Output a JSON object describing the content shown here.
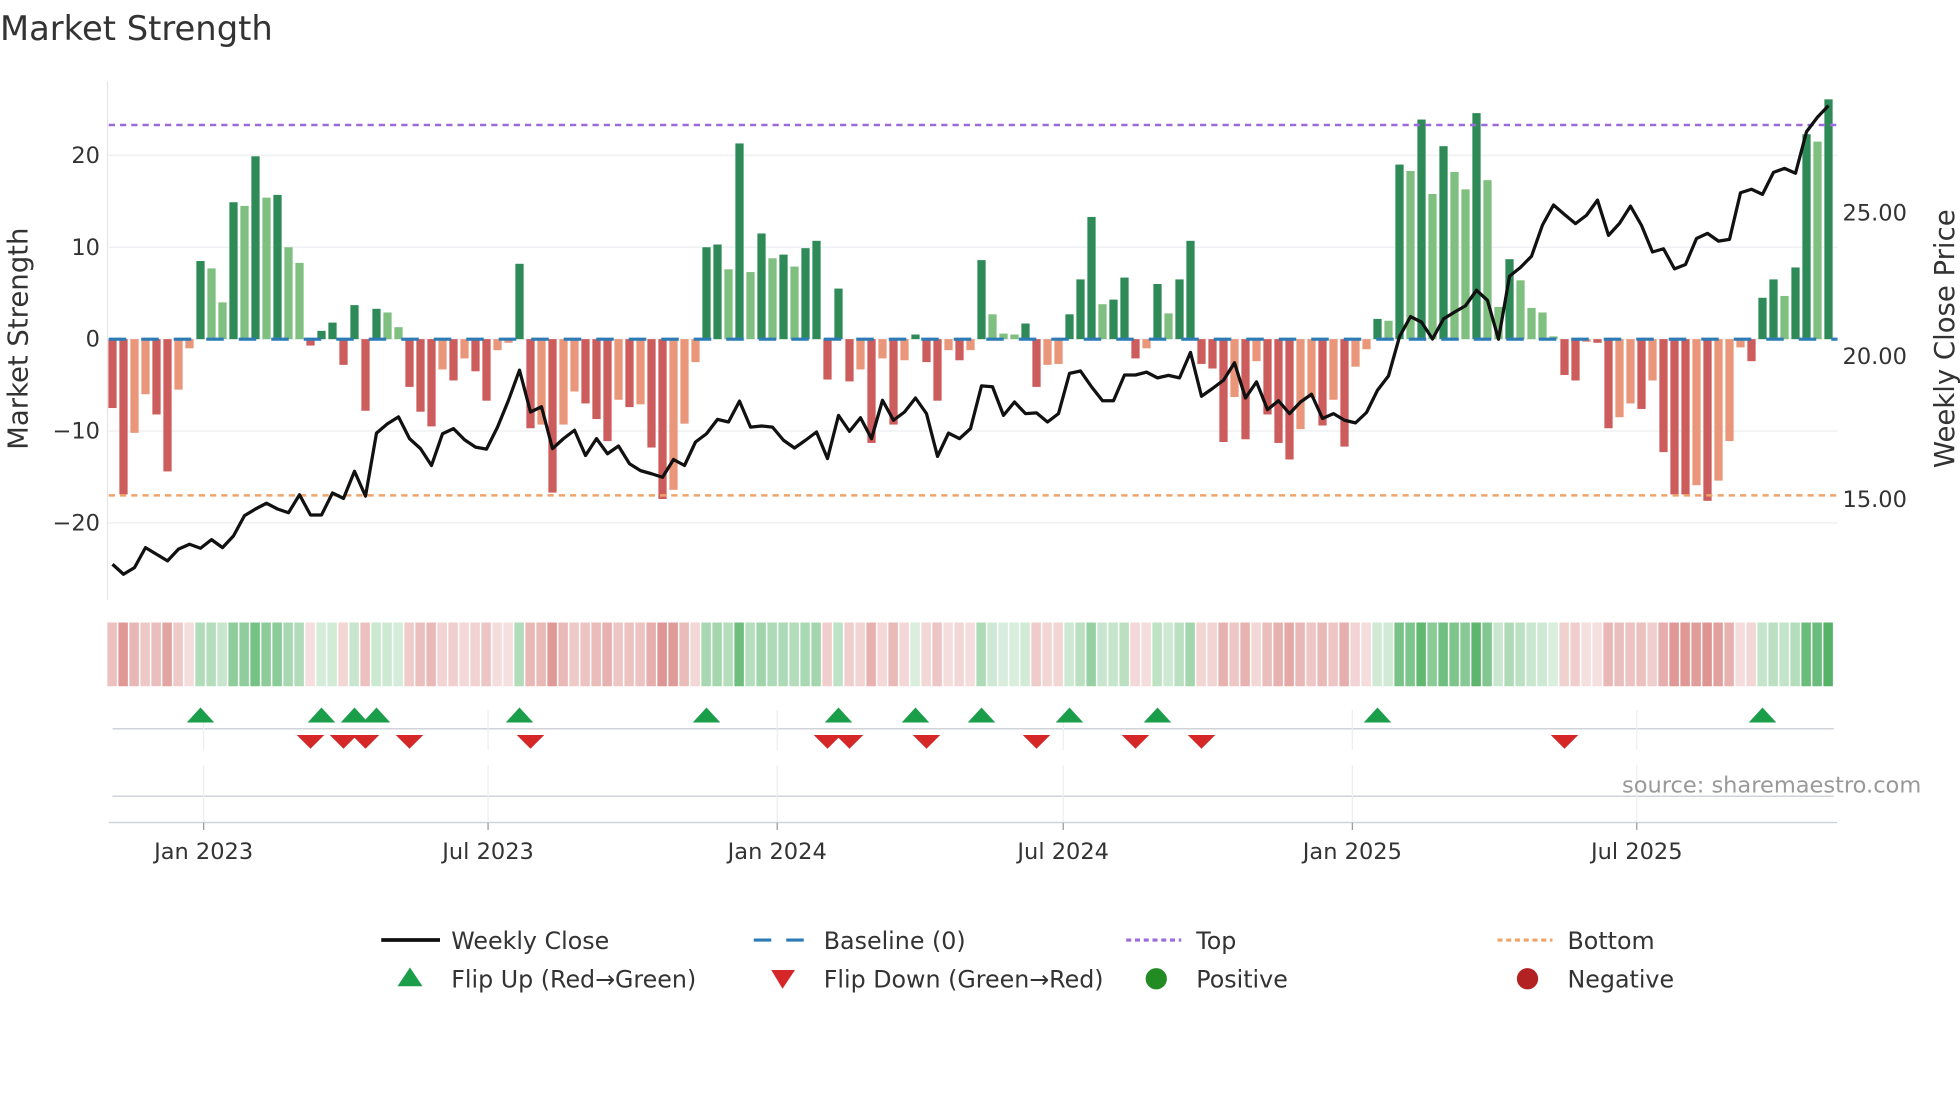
{
  "chart_data": {
    "type": "bar+line",
    "title": "Market Strength",
    "ylabel_left": "Market Strength",
    "ylabel_right": "Weekly Close Price",
    "left_ticks": [
      20,
      10,
      0,
      -10,
      -20
    ],
    "left_tick_labels": [
      "20",
      "10",
      "0",
      "−10",
      "−20"
    ],
    "right_ticks": [
      25,
      20,
      15
    ],
    "right_tick_labels": [
      "25.00",
      "20.00",
      "15.00"
    ],
    "ylim_left": [
      -25.5,
      28
    ],
    "start_date": "2022-11-04",
    "frequency": "weekly",
    "x_ticks": [
      {
        "date": "2023-01-01",
        "label": "Jan 2023"
      },
      {
        "date": "2023-07-01",
        "label": "Jul 2023"
      },
      {
        "date": "2024-01-01",
        "label": "Jan 2024"
      },
      {
        "date": "2024-07-01",
        "label": "Jul 2024"
      },
      {
        "date": "2025-01-01",
        "label": "Jan 2025"
      },
      {
        "date": "2025-07-01",
        "label": "Jul 2025"
      }
    ],
    "top_level": 23.3,
    "bottom_level": -17.0,
    "baseline": 0,
    "strength": [
      -7.5,
      -16.9,
      -10.2,
      -6.0,
      -8.2,
      -14.4,
      -5.5,
      -1.0,
      8.5,
      7.7,
      4.0,
      14.9,
      14.5,
      19.9,
      15.4,
      15.7,
      10.0,
      8.3,
      -0.7,
      0.9,
      1.8,
      -2.8,
      3.7,
      -7.8,
      3.3,
      2.9,
      1.3,
      -5.2,
      -7.9,
      -9.5,
      -3.3,
      -4.5,
      -2.1,
      -3.5,
      -6.7,
      -1.2,
      -0.4,
      8.2,
      -9.7,
      -9.3,
      -16.7,
      -9.3,
      -5.7,
      -7.0,
      -8.7,
      -11.1,
      -6.6,
      -7.4,
      -7.1,
      -11.8,
      -17.4,
      -16.4,
      -9.2,
      -2.5,
      10.0,
      10.3,
      7.6,
      21.3,
      7.3,
      11.5,
      8.8,
      9.2,
      7.9,
      9.9,
      10.7,
      -4.4,
      5.5,
      -4.6,
      -3.3,
      -11.3,
      -2.1,
      -9.3,
      -2.3,
      0.5,
      -2.5,
      -6.7,
      -1.2,
      -2.3,
      -1.2,
      8.6,
      2.7,
      0.6,
      0.5,
      1.7,
      -5.2,
      -2.8,
      -2.7,
      2.7,
      6.5,
      13.3,
      3.8,
      4.3,
      6.7,
      -2.1,
      -1.0,
      6.0,
      2.8,
      6.5,
      10.7,
      -2.7,
      -3.2,
      -11.2,
      -6.3,
      -10.9,
      -2.4,
      -8.2,
      -11.3,
      -13.1,
      -9.8,
      -6.4,
      -9.4,
      -6.6,
      -11.7,
      -3.0,
      -1.1,
      2.2,
      2.0,
      19.0,
      18.3,
      23.9,
      15.8,
      21.0,
      18.2,
      16.3,
      24.6,
      17.3,
      3.5,
      8.7,
      6.4,
      3.4,
      2.9,
      0.3,
      -3.9,
      -4.5,
      -0.3,
      -0.4,
      -9.7,
      -8.5,
      -7.0,
      -7.6,
      -4.5,
      -12.3,
      -16.9,
      -16.9,
      -15.9,
      -17.6,
      -15.4,
      -11.1,
      -0.9,
      -2.4,
      4.5,
      6.5,
      4.7,
      7.8,
      22.3,
      21.5,
      26.1
    ],
    "weekly_close": [
      12.69,
      12.34,
      12.57,
      13.27,
      13.04,
      12.81,
      13.22,
      13.39,
      13.25,
      13.55,
      13.27,
      13.68,
      14.39,
      14.62,
      14.82,
      14.62,
      14.49,
      15.12,
      14.41,
      14.41,
      15.18,
      14.99,
      15.94,
      15.07,
      17.27,
      17.6,
      17.84,
      17.08,
      16.73,
      16.14,
      17.25,
      17.43,
      17.04,
      16.78,
      16.71,
      17.48,
      18.42,
      19.47,
      18.01,
      18.19,
      16.73,
      17.08,
      17.37,
      16.49,
      17.08,
      16.55,
      16.82,
      16.2,
      15.96,
      15.85,
      15.73,
      16.35,
      16.14,
      16.96,
      17.25,
      17.75,
      17.66,
      18.39,
      17.48,
      17.52,
      17.48,
      17.02,
      16.75,
      17.02,
      17.31,
      16.38,
      17.89,
      17.33,
      17.81,
      17.08,
      18.42,
      17.72,
      18.01,
      18.5,
      17.95,
      16.46,
      17.27,
      17.08,
      17.43,
      18.92,
      18.89,
      17.89,
      18.36,
      17.95,
      17.98,
      17.66,
      17.95,
      19.36,
      19.44,
      18.89,
      18.4,
      18.4,
      19.3,
      19.3,
      19.4,
      19.2,
      19.29,
      19.2,
      20.09,
      18.56,
      18.83,
      19.12,
      19.73,
      18.5,
      19.06,
      18.09,
      18.4,
      17.95,
      18.36,
      18.63,
      17.78,
      17.95,
      17.72,
      17.63,
      17.99,
      18.77,
      19.27,
      20.64,
      21.34,
      21.15,
      20.56,
      21.26,
      21.5,
      21.72,
      22.26,
      21.91,
      20.55,
      22.75,
      23.06,
      23.45,
      24.54,
      25.24,
      24.91,
      24.59,
      24.88,
      25.41,
      24.18,
      24.6,
      25.2,
      24.53,
      23.6,
      23.71,
      23.01,
      23.16,
      24.07,
      24.25,
      23.98,
      24.04,
      25.67,
      25.79,
      25.61,
      26.38,
      26.52,
      26.35,
      27.8,
      28.31,
      28.71
    ],
    "legend": [
      {
        "label": "Weekly Close",
        "kind": "line",
        "color": "#111111"
      },
      {
        "label": "Baseline (0)",
        "kind": "dash",
        "color": "#2c7bb6"
      },
      {
        "label": "Top",
        "kind": "dot",
        "color": "#9b6bdc"
      },
      {
        "label": "Bottom",
        "kind": "dot",
        "color": "#f0a46a"
      },
      {
        "label": "Flip Up (Red→Green)",
        "kind": "tri-up",
        "color": "#1a9e4a"
      },
      {
        "label": "Flip Down (Green→Red)",
        "kind": "tri-down",
        "color": "#d62728"
      },
      {
        "label": "Positive",
        "kind": "circle",
        "color": "#228b22"
      },
      {
        "label": "Negative",
        "kind": "circle",
        "color": "#b22222"
      }
    ],
    "legend_placement": "bottom-center",
    "colors": {
      "pos_strong": "#2e8b57",
      "pos_weak": "#7fbf7f",
      "neg_strong": "#cd5c5c",
      "neg_weak": "#e9967a",
      "heat_pos": "#4caf60",
      "heat_neg": "#d06a66"
    },
    "source": "source: sharemaestro.com"
  }
}
